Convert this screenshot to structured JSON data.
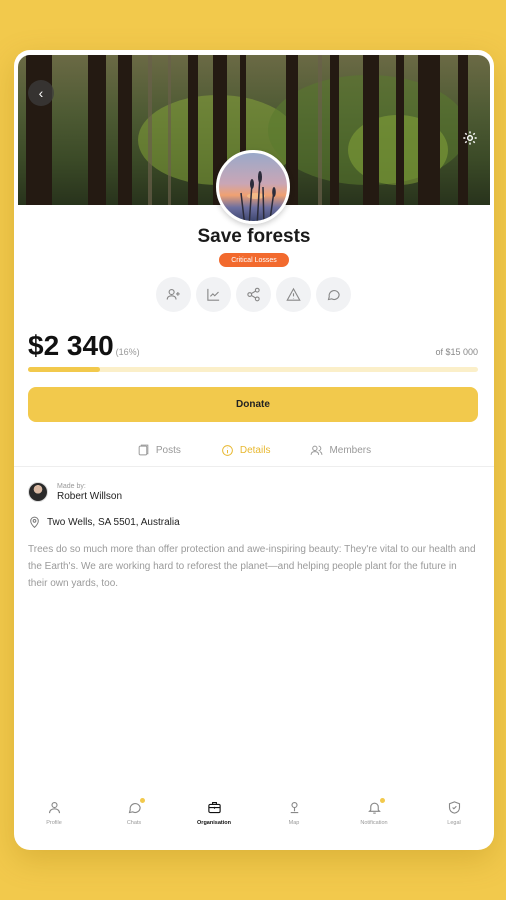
{
  "campaign": {
    "title": "Save forests",
    "badge": "Critical Losses",
    "amount": "$2 340",
    "percent": "(16%)",
    "goal": "of $15 000",
    "progress_fraction": 0.16,
    "donate_label": "Donate"
  },
  "actions": [
    {
      "icon": "add-user-icon"
    },
    {
      "icon": "chart-icon"
    },
    {
      "icon": "share-icon"
    },
    {
      "icon": "warning-icon"
    },
    {
      "icon": "comment-icon"
    }
  ],
  "tabs": [
    {
      "label": "Posts",
      "icon": "posts-icon",
      "active": false
    },
    {
      "label": "Details",
      "icon": "info-icon",
      "active": true
    },
    {
      "label": "Members",
      "icon": "members-icon",
      "active": false
    }
  ],
  "details": {
    "made_by_label": "Made by:",
    "author": "Robert Willson",
    "location": "Two Wells, SA 5501, Australia",
    "description": "Trees do so much more than offer protection and awe-inspiring beauty: They're vital to our health and the Earth's. We are working hard to reforest the planet—and helping people plant for the future in their own yards, too."
  },
  "nav": [
    {
      "label": "Profile",
      "icon": "profile-icon",
      "active": false,
      "dot": false
    },
    {
      "label": "Chats",
      "icon": "chat-icon",
      "active": false,
      "dot": true
    },
    {
      "label": "Organisation",
      "icon": "briefcase-icon",
      "active": true,
      "dot": false
    },
    {
      "label": "Map",
      "icon": "map-pin-icon",
      "active": false,
      "dot": false
    },
    {
      "label": "Notification",
      "icon": "bell-icon",
      "active": false,
      "dot": true
    },
    {
      "label": "Legal",
      "icon": "shield-icon",
      "active": false,
      "dot": false
    }
  ],
  "colors": {
    "accent": "#F2C94C",
    "badge": "#F26A2E",
    "active_tab": "#E8B830"
  }
}
